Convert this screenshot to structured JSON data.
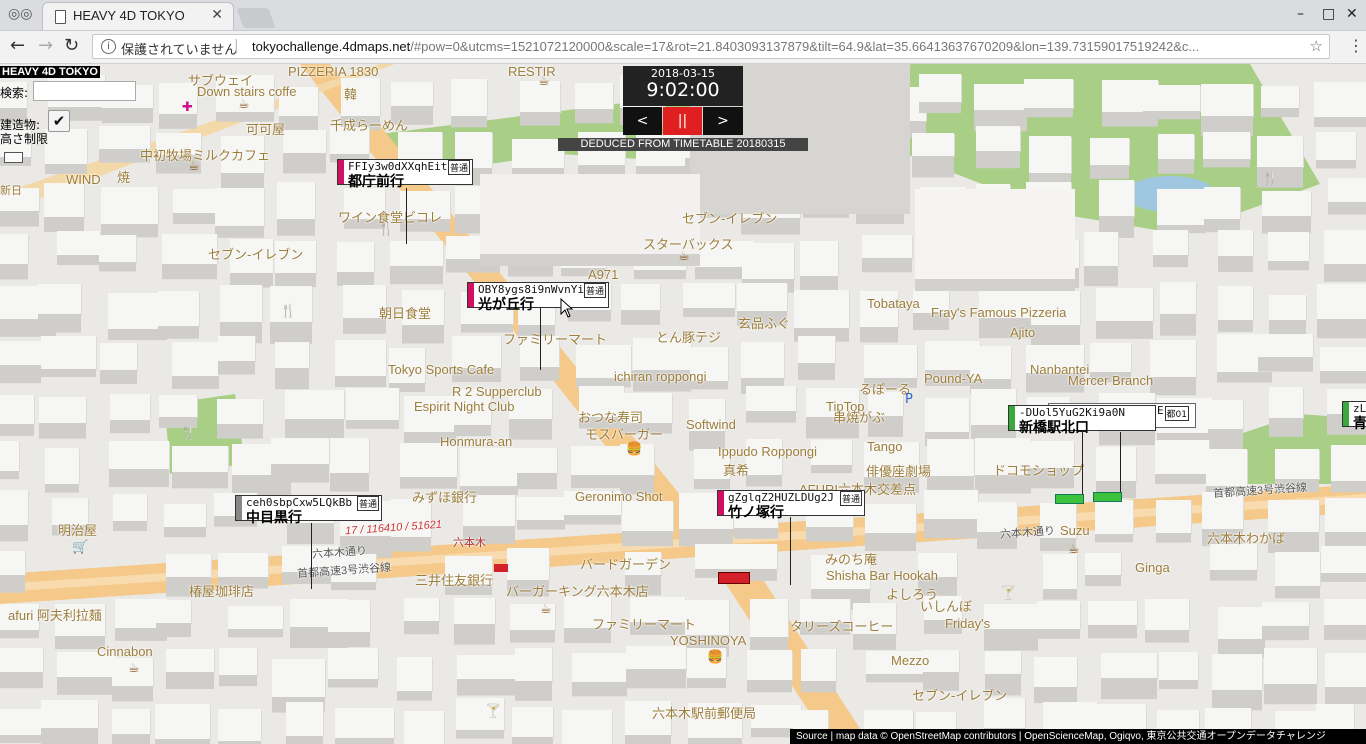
{
  "browser": {
    "tab_title": "HEAVY 4D TOKYO",
    "insecure_label": "保護されていません",
    "url_host": "tokyochallenge.4dmaps.net",
    "url_rest": "/#pow=0&utcms=1521072120000&scale=17&rot=21.8403093137879&tilt=64.9&lat=35.66413637670209&lon=139.73159017519242&c...",
    "close_glyph": "✕",
    "minimize_glyph": "–",
    "maximize_glyph": "□",
    "back_glyph": "←",
    "forward_glyph": "→",
    "reload_glyph": "↻",
    "star_glyph": "☆",
    "menu_glyph": "⋮",
    "info_glyph": "i"
  },
  "app": {
    "title": "HEAVY 4D TOKYO",
    "search_label": "検索:",
    "search_placeholder": "",
    "building_label_1": "建造物:",
    "building_label_2": "高さ制限",
    "building_checked": true
  },
  "clock": {
    "date": "2018-03-15",
    "time": "9:02:00",
    "prev_label": "<",
    "pause_label": "||",
    "next_label": ">",
    "deduced_text": "DEDUCED FROM TIMETABLE 20180315"
  },
  "stations": [
    {
      "code": "FFIy3w0dXXqhEitJ",
      "name": "都庁前行",
      "type": "普通",
      "color": "#d01060"
    },
    {
      "code": "OBY8ygs8i9nWvnYi",
      "name": "光が丘行",
      "type": "普通",
      "color": "#d01060"
    },
    {
      "code": "ceh0sbpCxw5LQkBb",
      "name": "中目黒行",
      "type": "普通",
      "color": "#888888"
    },
    {
      "code": "gZglqZ2HUZLDUg2J",
      "name": "竹ノ塚行",
      "type": "普通",
      "color": "#d01060"
    },
    {
      "code": "-DUol5YuG2Ki9a0N",
      "name": "新橋駅北口",
      "type": "都01",
      "extra_code": "E1",
      "color": "#3aa83a"
    },
    {
      "code": "zL",
      "name": "青",
      "type": "",
      "color": "#3aa83a"
    }
  ],
  "pois": [
    "PIZZERIA 1830",
    "RESTIR",
    "サブウェイ",
    "Down stairs coffe",
    "韓",
    "可可屋",
    "千成らーめん",
    "中初牧場ミルクカフェ",
    "WIND",
    "焼",
    "ワイン食堂ビコレ",
    "セブン-イレブン",
    "セブン-イレブン",
    "スターバックス",
    "A971",
    "朝日食堂",
    "ファミリーマート",
    "とん豚テジ",
    "玄品ふぐ",
    "Tobataya",
    "Fray's Famous Pizzeria",
    "Ajito",
    "Tokyo Sports Cafe",
    "ichiran roppongi",
    "R 2 Supperclub",
    "Espirit Night Club",
    "おつな寿司",
    "モスバーガー",
    "Softwind",
    "るぽーる",
    "TipTop",
    "Pound-YA",
    "Nanbantei",
    "Mercer Branch",
    "Honmura-an",
    "Ippudo Roppongi",
    "真希",
    "串焼がぶ",
    "Tango",
    "俳優座劇場",
    "AFURI六本木交差点",
    "ドコモショップ",
    "みずほ銀行",
    "Geronimo Shot",
    "明治屋",
    "六本木",
    "六本木通り",
    "六本木通り",
    "首都高速3号渋谷線",
    "首都高速3号渋谷線",
    "三井住友銀行",
    "バードガーデン",
    "バーガーキング六本木店",
    "みのち庵",
    "Shisha Bar Hookah",
    "よしろう",
    "いしんぼ",
    "Suzu",
    "Ginga",
    "六本木わかば",
    "椿屋珈琲店",
    "afuri 阿夫利拉麺",
    "ファミリーマート",
    "YOSHINOYA",
    "タリーズコーヒー",
    "Friday's",
    "Cinnabon",
    "Mezzo",
    "セブン-イレブン",
    "六本木駅前郵便局",
    "新日",
    "17 / 116410 / 51621"
  ],
  "attribution": "Source | map data © OpenStreetMap contributors | OpenScienceMap, Ogiqvo, 東京公共交通オープンデータチャレンジ"
}
